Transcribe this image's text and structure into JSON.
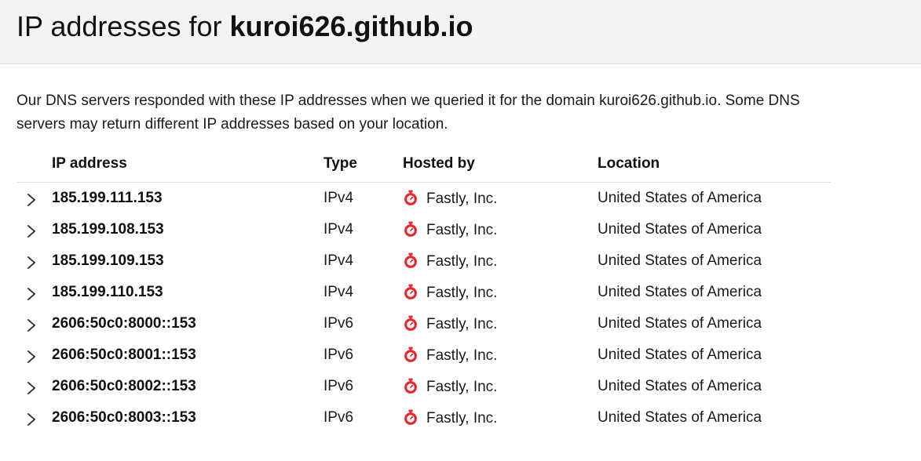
{
  "header": {
    "title_prefix": "IP addresses for ",
    "domain": "kuroi626.github.io"
  },
  "description": "Our DNS servers responded with these IP addresses when we queried it for the domain kuroi626.github.io. Some DNS servers may return different IP addresses based on your location.",
  "table": {
    "columns": {
      "ip": "IP address",
      "type": "Type",
      "hosted_by": "Hosted by",
      "location": "Location"
    },
    "rows": [
      {
        "ip": "185.199.111.153",
        "type": "IPv4",
        "hosted_by": "Fastly, Inc.",
        "location": "United States of America"
      },
      {
        "ip": "185.199.108.153",
        "type": "IPv4",
        "hosted_by": "Fastly, Inc.",
        "location": "United States of America"
      },
      {
        "ip": "185.199.109.153",
        "type": "IPv4",
        "hosted_by": "Fastly, Inc.",
        "location": "United States of America"
      },
      {
        "ip": "185.199.110.153",
        "type": "IPv4",
        "hosted_by": "Fastly, Inc.",
        "location": "United States of America"
      },
      {
        "ip": "2606:50c0:8000::153",
        "type": "IPv6",
        "hosted_by": "Fastly, Inc.",
        "location": "United States of America"
      },
      {
        "ip": "2606:50c0:8001::153",
        "type": "IPv6",
        "hosted_by": "Fastly, Inc.",
        "location": "United States of America"
      },
      {
        "ip": "2606:50c0:8002::153",
        "type": "IPv6",
        "hosted_by": "Fastly, Inc.",
        "location": "United States of America"
      },
      {
        "ip": "2606:50c0:8003::153",
        "type": "IPv6",
        "hosted_by": "Fastly, Inc.",
        "location": "United States of America"
      }
    ]
  },
  "icons": {
    "expand": "chevron-right-icon",
    "host": "fastly-logo-icon"
  },
  "colors": {
    "header_bg": "#f3f3f3",
    "host_icon": "#e8282b",
    "divider": "#dcdcdc"
  }
}
